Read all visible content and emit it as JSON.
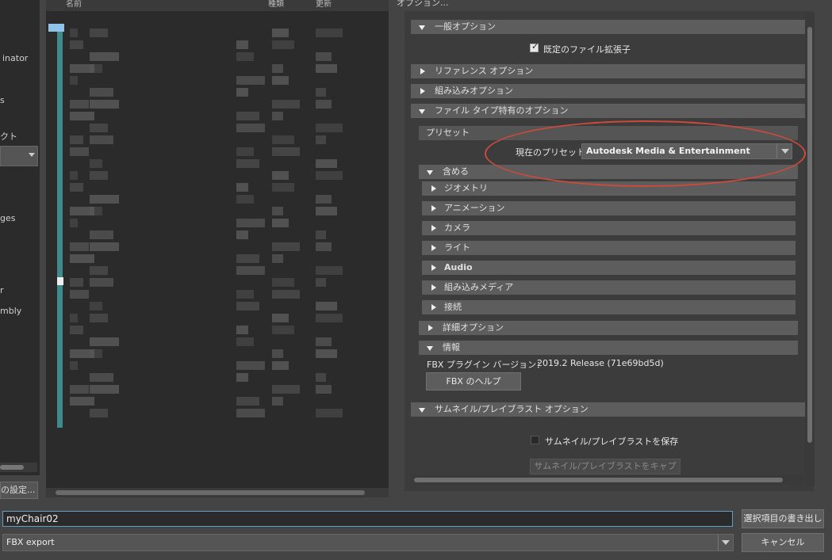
{
  "sidebar": {
    "labels": [
      "inator",
      "s",
      "クト",
      "ges",
      "r",
      "mbly"
    ],
    "combo_value": "",
    "settings_button": "の設定..."
  },
  "file_list": {
    "headers": [
      "名前",
      "種類",
      "更新"
    ]
  },
  "options": {
    "title": "オプション...",
    "general_section": "一般オプション",
    "default_extension_label": "既定のファイル拡張子",
    "reference_options": "リファレンス オプション",
    "embedded_options": "組み込みオプション",
    "file_type_options": "ファイル タイプ特有のオプション",
    "preset_header": "プリセット",
    "current_preset_label": "現在のプリセット:",
    "current_preset_value": "Autodesk Media & Entertainment",
    "include_section": "含める",
    "include_items": [
      "ジオメトリ",
      "アニメーション",
      "カメラ",
      "ライト",
      "Audio",
      "組み込みメディア",
      "接続"
    ],
    "advanced_options": "詳細オプション",
    "info_section": "情報",
    "fbx_version_label": "FBX プラグイン バージョン：",
    "fbx_version_value": "2019.2 Release (71e69bd5d)",
    "fbx_help_button": "FBX のヘルプ",
    "thumbnail_section": "サムネイル/プレイブラスト オプション",
    "save_thumbnail_label": "サムネイル/プレイブラストを保存",
    "capture_thumbnail_button": "サムネイル/プレイブラストをキャプチャ"
  },
  "bottom": {
    "filename_value": "myChair02",
    "filetype_value": "FBX export",
    "export_button": "選択項目の書き出し",
    "cancel_button": "キャンセル"
  },
  "colors": {
    "annotation": "#c94b3d",
    "focus_border": "#5fa0c8",
    "list_accent": "#3f8a8a"
  }
}
